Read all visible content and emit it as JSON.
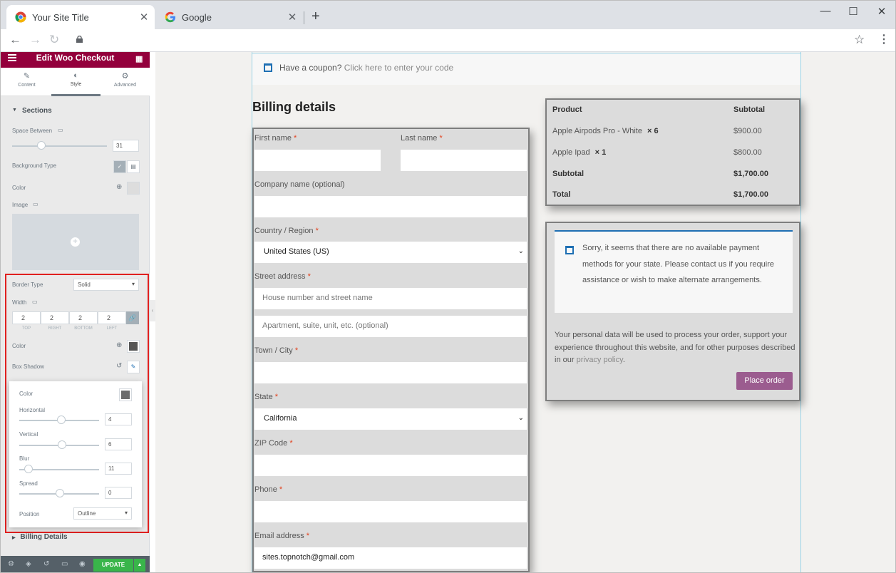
{
  "browser": {
    "tabs": [
      {
        "title": "Your Site Title",
        "active": true,
        "icon": "chrome-icon"
      },
      {
        "title": "Google",
        "active": false,
        "icon": "google-icon"
      }
    ],
    "new_tab": "+",
    "window_controls": {
      "minimize": "—",
      "maximize": "☐",
      "close": "✕"
    }
  },
  "panel": {
    "title": "Edit Woo Checkout",
    "tabs": [
      {
        "label": "Content",
        "icon": "pencil-icon"
      },
      {
        "label": "Style",
        "icon": "contrast-icon",
        "active": true
      },
      {
        "label": "Advanced",
        "icon": "gear-icon"
      }
    ],
    "section_title": "Sections",
    "space_between_label": "Space Between",
    "space_between_value": "31",
    "background_type_label": "Background Type",
    "color_label": "Color",
    "image_label": "Image",
    "border_type_label": "Border Type",
    "border_type_value": "Solid",
    "width_label": "Width",
    "width_values": [
      "2",
      "2",
      "2",
      "2"
    ],
    "width_sides": [
      "TOP",
      "RIGHT",
      "BOTTOM",
      "LEFT"
    ],
    "border_color_label": "Color",
    "box_shadow_label": "Box Shadow",
    "shadow": {
      "color_label": "Color",
      "horizontal_label": "Horizontal",
      "horizontal_value": "4",
      "vertical_label": "Vertical",
      "vertical_value": "6",
      "blur_label": "Blur",
      "blur_value": "11",
      "spread_label": "Spread",
      "spread_value": "0",
      "position_label": "Position",
      "position_value": "Outline"
    },
    "billing_details_label": "Billing Details",
    "update_label": "UPDATE",
    "border_color": "#555555",
    "highlight_color": "#e0201f"
  },
  "checkout": {
    "coupon_text": "Have a coupon?",
    "coupon_link": "Click here to enter your code",
    "billing_title": "Billing details",
    "fields": {
      "first_name": "First name",
      "last_name": "Last name",
      "company": "Company name (optional)",
      "country": "Country / Region",
      "country_value": "United States (US)",
      "street": "Street address",
      "street_placeholder": "House number and street name",
      "street2_placeholder": "Apartment, suite, unit, etc. (optional)",
      "city": "Town / City",
      "state": "State",
      "state_value": "California",
      "zip": "ZIP Code",
      "phone": "Phone",
      "email": "Email address",
      "email_value": "sites.topnotch@gmail.com"
    },
    "required_mark": "*",
    "order": {
      "header_product": "Product",
      "header_subtotal": "Subtotal",
      "items": [
        {
          "name": "Apple Airpods Pro - White",
          "qty": "× 6",
          "total": "$900.00"
        },
        {
          "name": "Apple Ipad",
          "qty": "× 1",
          "total": "$800.00"
        }
      ],
      "subtotal_label": "Subtotal",
      "subtotal_value": "$1,700.00",
      "total_label": "Total",
      "total_value": "$1,700.00"
    },
    "payment_notice": "Sorry, it seems that there are no available payment methods for your state. Please contact us if you require assistance or wish to make alternate arrangements.",
    "privacy_text": "Your personal data will be used to process your order, support your experience throughout this website, and for other purposes described in our",
    "privacy_link": "privacy policy",
    "privacy_end": ".",
    "place_order": "Place order",
    "accent_color": "#9b5c8f"
  }
}
